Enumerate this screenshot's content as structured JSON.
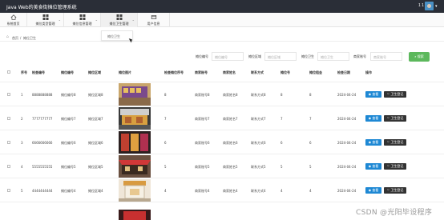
{
  "app": {
    "title": "Java Web的美食街摊位管理系统",
    "user_count": "1 1"
  },
  "nav": {
    "items": [
      {
        "label": "系统首页",
        "icon": "home-icon"
      },
      {
        "label": "摊位类型管理",
        "icon": "grid-icon"
      },
      {
        "label": "摊位信息管理",
        "icon": "grid-icon"
      },
      {
        "label": "摊位卫生管理",
        "icon": "grid-icon"
      },
      {
        "label": "用户信息",
        "icon": "card-icon"
      }
    ],
    "dropdown_item": "摊位卫生"
  },
  "breadcrumb": {
    "home": "首页",
    "current": "摊位卫生"
  },
  "search": {
    "fields": [
      {
        "label": "摊位编号",
        "placeholder": "摊位编号"
      },
      {
        "label": "摊位区域",
        "placeholder": "摊位区域"
      },
      {
        "label": "摊位卫生",
        "placeholder": "摊位卫生"
      },
      {
        "label": "商家账号",
        "placeholder": "商家账号"
      }
    ],
    "button": "搜索"
  },
  "table": {
    "headers": [
      "序号",
      "检查编号",
      "摊位编号",
      "摊位区域",
      "摊位图片",
      "检查摊位序号",
      "商家账号",
      "商家姓名",
      "联系方式",
      "摊位号",
      "摊位租金",
      "检查日期",
      "操作"
    ],
    "rows": [
      {
        "no": "1",
        "check": "8888888888",
        "stall": "摊位编号8",
        "area": "摊位区域8",
        "seq": "8",
        "account": "商家账号8",
        "name": "商家姓名8",
        "phone": "联系方式8",
        "num": "8",
        "rent": "8",
        "date": "2024-04-24"
      },
      {
        "no": "2",
        "check": "7777777777",
        "stall": "摊位编号7",
        "area": "摊位区域7",
        "seq": "7",
        "account": "商家账号7",
        "name": "商家姓名7",
        "phone": "联系方式7",
        "num": "7",
        "rent": "7",
        "date": "2024-04-24"
      },
      {
        "no": "3",
        "check": "6666666666",
        "stall": "摊位编号6",
        "area": "摊位区域6",
        "seq": "6",
        "account": "商家账号6",
        "name": "商家姓名6",
        "phone": "联系方式6",
        "num": "6",
        "rent": "6",
        "date": "2024-04-24"
      },
      {
        "no": "4",
        "check": "5555555555",
        "stall": "摊位编号5",
        "area": "摊位区域5",
        "seq": "5",
        "account": "商家账号5",
        "name": "商家姓名5",
        "phone": "联系方式5",
        "num": "5",
        "rent": "5",
        "date": "2024-04-24"
      },
      {
        "no": "5",
        "check": "4444444444",
        "stall": "摊位编号4",
        "area": "摊位区域4",
        "seq": "4",
        "account": "商家账号4",
        "name": "商家姓名4",
        "phone": "联系方式4",
        "num": "4",
        "rent": "4",
        "date": "2024-04-24"
      }
    ],
    "view_label": "查看",
    "register_label": "卫生登记"
  },
  "watermark": "CSDN @光阳毕设程序",
  "colors": {
    "topbar": "#2a2e37",
    "search_button": "#5cb85c",
    "view_button": "#1e88d4",
    "register_button": "#333333"
  }
}
